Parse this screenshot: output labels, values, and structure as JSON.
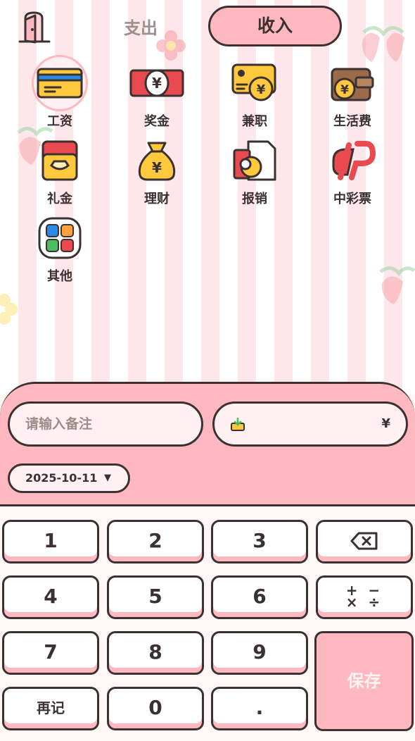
{
  "header": {
    "back_icon": "door-icon",
    "tab_expense": "支出",
    "tab_income": "收入"
  },
  "categories": [
    {
      "label": "工资",
      "icon": "salary-card-icon",
      "selected": true
    },
    {
      "label": "奖金",
      "icon": "bonus-cash-icon"
    },
    {
      "label": "兼职",
      "icon": "parttime-icon"
    },
    {
      "label": "生活费",
      "icon": "wallet-icon"
    },
    {
      "label": "礼金",
      "icon": "gift-money-icon"
    },
    {
      "label": "理财",
      "icon": "money-bag-icon"
    },
    {
      "label": "报销",
      "icon": "reimburse-icon"
    },
    {
      "label": "中彩票",
      "icon": "lottery-icon"
    },
    {
      "label": "其他",
      "icon": "other-apps-icon"
    }
  ],
  "form": {
    "note_placeholder": "请输入备注",
    "currency_symbol": "¥",
    "date": "2025-10-11"
  },
  "keypad": {
    "k1": "1",
    "k2": "2",
    "k3": "3",
    "k4": "4",
    "k5": "5",
    "k6": "6",
    "k7": "7",
    "k8": "8",
    "k9": "9",
    "k0": "0",
    "dot": ".",
    "again": "再记",
    "save": "保存",
    "ops_top": "+ −",
    "ops_bottom": "× ÷"
  },
  "colors": {
    "accent": "#ffb8bf",
    "outline": "#3b3131",
    "background": "#fff6f6"
  }
}
